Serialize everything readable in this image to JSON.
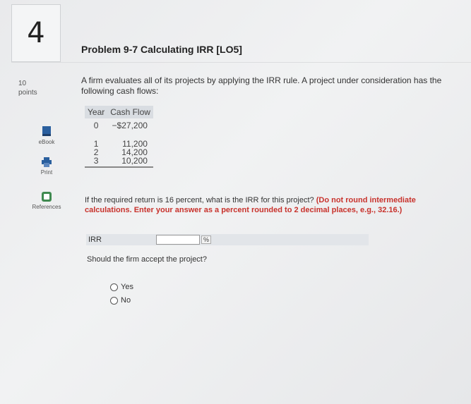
{
  "question_number": "4",
  "points": {
    "value": "10",
    "label": "points"
  },
  "sidebar": {
    "ebook": "eBook",
    "print": "Print",
    "references": "References"
  },
  "problem": {
    "title": "Problem 9-7 Calculating IRR [LO5]",
    "prompt": "A firm evaluates all of its projects by applying the IRR rule. A project under consideration has the following cash flows:"
  },
  "cash_flow_table": {
    "headers": [
      "Year",
      "Cash Flow"
    ],
    "rows": [
      {
        "year": "0",
        "cash_flow": "−$27,200"
      },
      {
        "year": "1",
        "cash_flow": "11,200"
      },
      {
        "year": "2",
        "cash_flow": "14,200"
      },
      {
        "year": "3",
        "cash_flow": "10,200"
      }
    ]
  },
  "question": {
    "text": "If the required return is 16 percent, what is the IRR for this project?",
    "instructions": "(Do not round intermediate calculations. Enter your answer as a percent rounded to 2 decimal places, e.g., 32.16.)"
  },
  "irr": {
    "label": "IRR",
    "value": "",
    "unit": "%"
  },
  "accept": {
    "question": "Should the firm accept the project?",
    "options": [
      "Yes",
      "No"
    ]
  }
}
